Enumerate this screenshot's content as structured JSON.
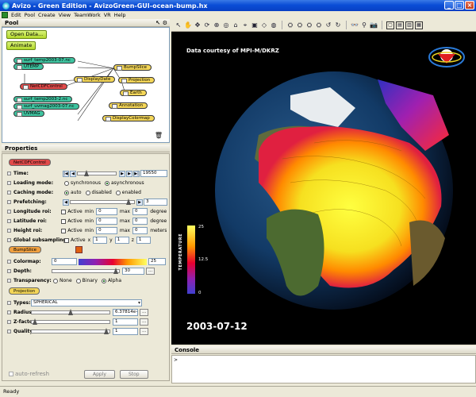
{
  "window": {
    "title": "Avizo - Green Edition - AvizoGreen-GUI-ocean-bump.hx"
  },
  "menu": [
    "Edit",
    "Pool",
    "Create",
    "View",
    "TeamWork",
    "VR",
    "Help"
  ],
  "pool": {
    "title": "Pool",
    "open_data": "Open Data...",
    "animate": "Animate",
    "nodes": [
      "surf_temp2003-07.nc",
      "UTEMP",
      "NetCDFControl",
      "DisplayDate",
      "BumpSlice",
      "Projection",
      "Earth",
      "surf_temp2003-2.nc",
      "surf_uvmag2003-07.nc",
      "UVMAG",
      "Annotation",
      "DisplayColormap"
    ]
  },
  "properties": {
    "title": "Properties",
    "netcdf_control": "NetCDFControl",
    "time_label": "Time:",
    "time_value": "19550",
    "time_slider": 0.18,
    "loading_label": "Loading mode:",
    "loading_options": [
      "synchronous",
      "asynchronous"
    ],
    "loading_selected": 1,
    "caching_label": "Caching mode:",
    "caching_options": [
      "auto",
      "disabled",
      "enabled"
    ],
    "caching_selected": 0,
    "prefetch_label": "Prefetching:",
    "prefetch_value": "3",
    "prefetch_slider": 0.95,
    "roi_rows": [
      {
        "label": "Longitude roi:",
        "active": "Active",
        "min_label": "min",
        "min": "0",
        "max_label": "max",
        "max": "0",
        "unit": "degrees e"
      },
      {
        "label": "Latitude roi:",
        "active": "Active",
        "min_label": "min",
        "min": "0",
        "max_label": "max",
        "max": "0",
        "unit": "degrees n"
      },
      {
        "label": "Height roi:",
        "active": "Active",
        "min_label": "min",
        "min": "0",
        "max_label": "max",
        "max": "0",
        "unit": "meters (p"
      }
    ],
    "global_label": "Global subsampling:",
    "global_active": "Active",
    "global_xyz": [
      {
        "axis": "x",
        "value": "1"
      },
      {
        "axis": "y",
        "value": "1"
      },
      {
        "axis": "z",
        "value": "1"
      }
    ],
    "bumpslice": "BumpSlice",
    "colormap_label": "Colormap:",
    "colormap_min": "0",
    "colormap_max": "25",
    "depth_label": "Depth:",
    "depth_value": "30",
    "depth_slider": 0.99,
    "transparency_label": "Transparency:",
    "transparency_options": [
      "None",
      "Binary",
      "Alpha"
    ],
    "transparency_selected": 2,
    "projection": "Projection",
    "types_label": "Types:",
    "types_value": "SPHERICAL",
    "radius_label": "Radius:",
    "radius_value": "6.37814e+6",
    "radius_slider": 0.5,
    "zfactor_label": "Z-factor:",
    "zfactor_value": "1",
    "zfactor_slider": 0.01,
    "quality_label": "Quality:",
    "quality_value": "1",
    "quality_slider": 0.99,
    "ellipsis": "...",
    "auto_refresh": "auto-refresh",
    "apply": "Apply",
    "stop": "Stop"
  },
  "viewer": {
    "credit": "Data courtesy of MPI-M/DKRZ",
    "date": "2003-07-12",
    "colorbar_title": "TEMPERATURE",
    "colorbar_max": "25",
    "colorbar_mid": "12.5",
    "colorbar_min": "0"
  },
  "console": {
    "title": "Console",
    "prompt": ">"
  },
  "status": {
    "text": "Ready"
  }
}
